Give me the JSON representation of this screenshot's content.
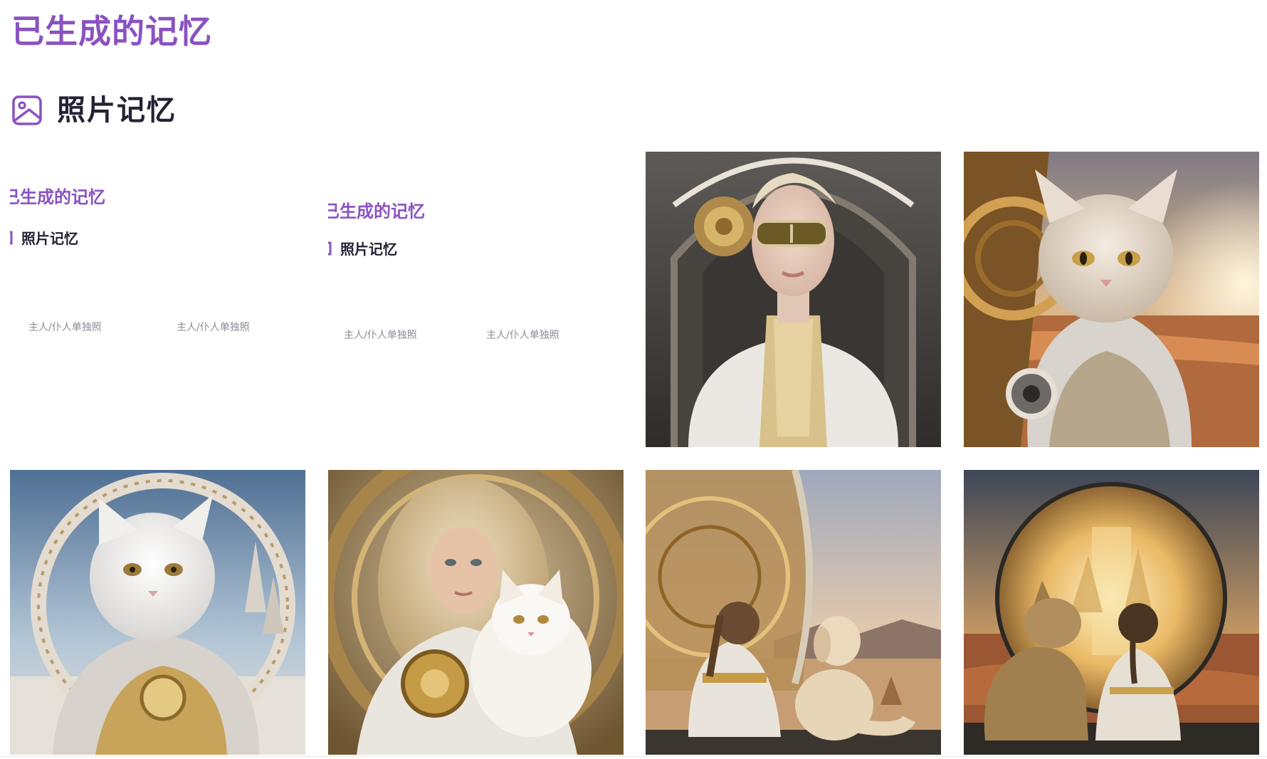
{
  "page": {
    "title": "已生成的记忆"
  },
  "section": {
    "title": "照片记忆",
    "icon": "image-icon"
  },
  "colors": {
    "accent": "#8a52c1",
    "heading": "#262135",
    "caption": "#8d8a97"
  },
  "nested_screenshots": [
    {
      "title": "已生成的记忆",
      "section": "照片记忆",
      "captions": [
        "主人/仆人单独照",
        "主人/仆人单独照"
      ]
    },
    {
      "title": "已生成的记忆",
      "section": "照片记忆",
      "captions": [
        "主人/仆人单独照",
        "主人/仆人单独照"
      ]
    }
  ],
  "photos": [
    {
      "subject": "woman-in-white-gold-outfit-with-sunglasses"
    },
    {
      "subject": "fluffy-cat-in-gold-armor-desert-sunset"
    },
    {
      "subject": "white-cat-in-gold-armor-ring-sky"
    },
    {
      "subject": "curly-blonde-woman-holding-white-cat"
    },
    {
      "subject": "woman-and-dog-sitting-facing-desert"
    },
    {
      "subject": "dog-and-woman-in-front-of-glowing-sphere"
    }
  ]
}
